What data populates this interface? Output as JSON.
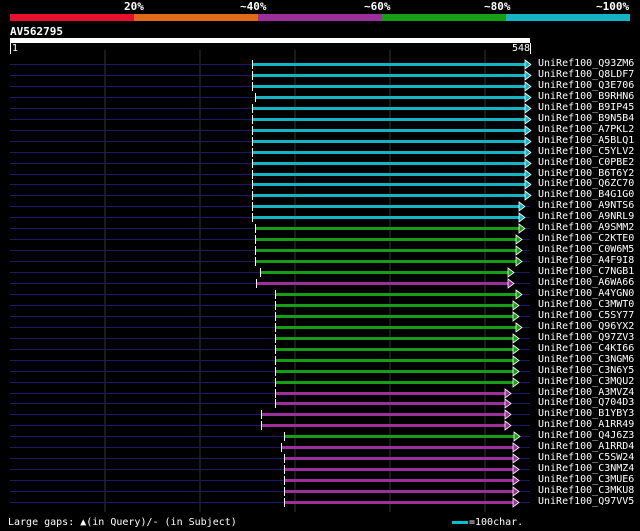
{
  "legend": {
    "colors": [
      "#e8102f",
      "#e06a1a",
      "#9c2f9c",
      "#179e17",
      "#14b4c4"
    ],
    "labels": [
      "20%",
      "~40%",
      "~60%",
      "~80%",
      "~100%"
    ]
  },
  "query": {
    "name": "AV562795",
    "start": "1",
    "end": "548"
  },
  "footer": {
    "gaps_text": "Large gaps: ▲(in Query)/- (in Subject)",
    "scale_text": "=100char."
  },
  "hits": [
    {
      "label": "UniRef100_Q93ZM6",
      "start": 252,
      "end": 525,
      "color": "#14b4c4"
    },
    {
      "label": "UniRef100_Q8LDF7",
      "start": 252,
      "end": 525,
      "color": "#14b4c4"
    },
    {
      "label": "UniRef100_Q3E706",
      "start": 252,
      "end": 525,
      "color": "#14b4c4"
    },
    {
      "label": "UniRef100_B9RHN6",
      "start": 255,
      "end": 525,
      "color": "#14b4c4"
    },
    {
      "label": "UniRef100_B9IP45",
      "start": 252,
      "end": 525,
      "color": "#14b4c4"
    },
    {
      "label": "UniRef100_B9N5B4",
      "start": 252,
      "end": 525,
      "color": "#14b4c4"
    },
    {
      "label": "UniRef100_A7PKL2",
      "start": 252,
      "end": 525,
      "color": "#14b4c4"
    },
    {
      "label": "UniRef100_A5BLQ1",
      "start": 252,
      "end": 525,
      "color": "#14b4c4"
    },
    {
      "label": "UniRef100_C5YLV2",
      "start": 252,
      "end": 525,
      "color": "#14b4c4"
    },
    {
      "label": "UniRef100_C0PBE2",
      "start": 252,
      "end": 525,
      "color": "#14b4c4"
    },
    {
      "label": "UniRef100_B6T6Y2",
      "start": 252,
      "end": 525,
      "color": "#14b4c4"
    },
    {
      "label": "UniRef100_Q6ZC70",
      "start": 252,
      "end": 525,
      "color": "#14b4c4"
    },
    {
      "label": "UniRef100_B4G1G0",
      "start": 252,
      "end": 525,
      "color": "#14b4c4"
    },
    {
      "label": "UniRef100_A9NTS6",
      "start": 252,
      "end": 519,
      "color": "#14b4c4"
    },
    {
      "label": "UniRef100_A9NRL9",
      "start": 252,
      "end": 519,
      "color": "#14b4c4"
    },
    {
      "label": "UniRef100_A9SMM2",
      "start": 255,
      "end": 519,
      "color": "#179e17"
    },
    {
      "label": "UniRef100_C2KTE0",
      "start": 255,
      "end": 516,
      "color": "#179e17"
    },
    {
      "label": "UniRef100_C0W6M5",
      "start": 255,
      "end": 516,
      "color": "#179e17"
    },
    {
      "label": "UniRef100_A4F9I8",
      "start": 255,
      "end": 516,
      "color": "#179e17"
    },
    {
      "label": "UniRef100_C7NGB1",
      "start": 260,
      "end": 508,
      "color": "#179e17"
    },
    {
      "label": "UniRef100_A6WA66",
      "start": 256,
      "end": 508,
      "color": "#9c2f9c"
    },
    {
      "label": "UniRef100_A4YGN0",
      "start": 275,
      "end": 516,
      "color": "#179e17"
    },
    {
      "label": "UniRef100_C3MWT0",
      "start": 275,
      "end": 513,
      "color": "#179e17"
    },
    {
      "label": "UniRef100_C5SY77",
      "start": 275,
      "end": 513,
      "color": "#179e17"
    },
    {
      "label": "UniRef100_Q96YX2",
      "start": 275,
      "end": 516,
      "color": "#179e17"
    },
    {
      "label": "UniRef100_Q97ZV3",
      "start": 275,
      "end": 513,
      "color": "#179e17"
    },
    {
      "label": "UniRef100_C4KI66",
      "start": 275,
      "end": 513,
      "color": "#179e17"
    },
    {
      "label": "UniRef100_C3NGM6",
      "start": 275,
      "end": 513,
      "color": "#179e17"
    },
    {
      "label": "UniRef100_C3N6Y5",
      "start": 275,
      "end": 513,
      "color": "#179e17"
    },
    {
      "label": "UniRef100_C3MQU2",
      "start": 275,
      "end": 513,
      "color": "#179e17"
    },
    {
      "label": "UniRef100_A3MVZ4",
      "start": 275,
      "end": 505,
      "color": "#9c2f9c"
    },
    {
      "label": "UniRef100_Q704D3",
      "start": 275,
      "end": 505,
      "color": "#9c2f9c"
    },
    {
      "label": "UniRef100_B1YBY3",
      "start": 261,
      "end": 505,
      "color": "#9c2f9c"
    },
    {
      "label": "UniRef100_A1RR49",
      "start": 261,
      "end": 505,
      "color": "#9c2f9c"
    },
    {
      "label": "UniRef100_Q4J6Z3",
      "start": 284,
      "end": 514,
      "color": "#179e17"
    },
    {
      "label": "UniRef100_A1RRD4",
      "start": 281,
      "end": 513,
      "color": "#9c2f9c"
    },
    {
      "label": "UniRef100_C5SW24",
      "start": 284,
      "end": 513,
      "color": "#9c2f9c"
    },
    {
      "label": "UniRef100_C3NMZ4",
      "start": 284,
      "end": 513,
      "color": "#9c2f9c"
    },
    {
      "label": "UniRef100_C3MUE6",
      "start": 284,
      "end": 513,
      "color": "#9c2f9c"
    },
    {
      "label": "UniRef100_C3MKU8",
      "start": 284,
      "end": 513,
      "color": "#9c2f9c"
    },
    {
      "label": "UniRef100_Q97VV5",
      "start": 284,
      "end": 513,
      "color": "#9c2f9c"
    }
  ]
}
